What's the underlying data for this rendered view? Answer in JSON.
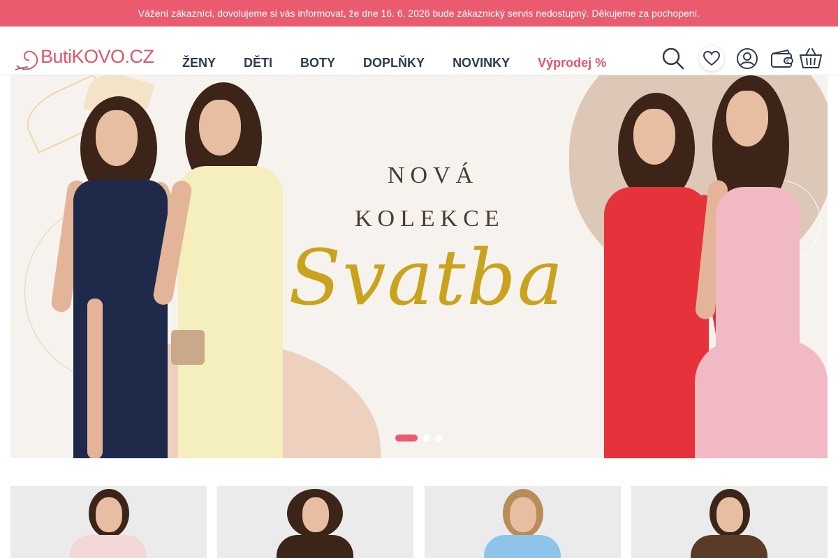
{
  "notice": {
    "text": "Vážení zákazníci, dovolujeme si vás informovat, že dne 16. 6. 2026 bude zákaznický servis nedostupný. Děkujeme za pochopení."
  },
  "header": {
    "logo_text": "ButiKOVO.CZ",
    "nav": [
      {
        "label": "ŽENY"
      },
      {
        "label": "DĚTI"
      },
      {
        "label": "BOTY"
      },
      {
        "label": "DOPLŇKY"
      },
      {
        "label": "NOVINKY"
      },
      {
        "label": "Výprodej %"
      }
    ],
    "icons": [
      "search-icon",
      "heart-icon",
      "user-icon",
      "wallet-icon",
      "basket-icon"
    ]
  },
  "banner": {
    "line1": "NOVÁ",
    "line2": "KOLEKCE",
    "script": "Svatba",
    "slides": 3,
    "active_slide": 1
  },
  "categories": [
    {
      "id": "cat-1",
      "accent": "#f3d6d6"
    },
    {
      "id": "cat-2",
      "accent": "#3c2418"
    },
    {
      "id": "cat-3",
      "accent": "#8fc4ea"
    },
    {
      "id": "cat-4",
      "accent": "#5a3b27"
    }
  ],
  "colors": {
    "brand": "#ea5b70",
    "text": "#2f3a4b",
    "gold": "#c9a31e"
  }
}
